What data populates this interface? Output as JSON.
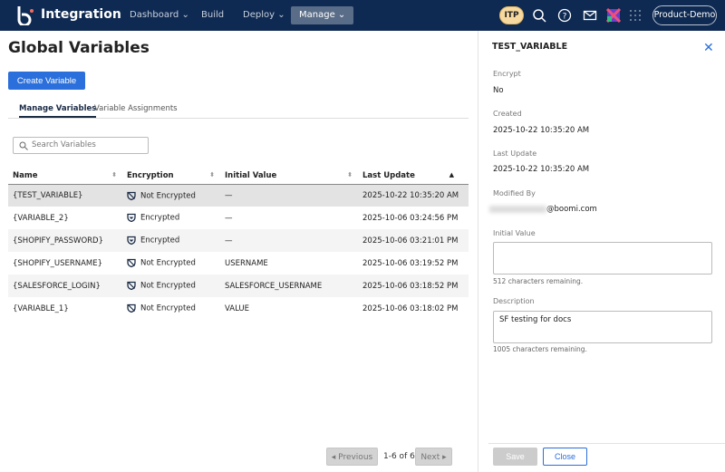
{
  "header": {
    "brand": "Integration",
    "nav": [
      {
        "label": "Dashboard"
      },
      {
        "label": "Build"
      },
      {
        "label": "Deploy"
      },
      {
        "label": "Manage"
      }
    ],
    "account_badge": "ITP",
    "profile": "Product-Demo"
  },
  "page": {
    "title": "Global Variables",
    "create_label": "Create Variable",
    "tabs": [
      {
        "label": "Manage Variables"
      },
      {
        "label": "Variable Assignments"
      }
    ],
    "search_placeholder": "Search Variables"
  },
  "table": {
    "columns": [
      "Name",
      "Encryption",
      "Initial Value",
      "Last Update"
    ],
    "sort": {
      "column": "Last Update",
      "direction": "descending"
    },
    "rows": [
      {
        "name": "{TEST_VARIABLE}",
        "encryption": "Not Encrypted",
        "initial": "—",
        "updated": "2025-10-22 10:35:20 AM"
      },
      {
        "name": "{VARIABLE_2}",
        "encryption": "Encrypted",
        "initial": "—",
        "updated": "2025-10-06 03:24:56 PM"
      },
      {
        "name": "{SHOPIFY_PASSWORD}",
        "encryption": "Encrypted",
        "initial": "—",
        "updated": "2025-10-06 03:21:01 PM"
      },
      {
        "name": "{SHOPIFY_USERNAME}",
        "encryption": "Not Encrypted",
        "initial": "USERNAME",
        "updated": "2025-10-06 03:19:52 PM"
      },
      {
        "name": "{SALESFORCE_LOGIN}",
        "encryption": "Not Encrypted",
        "initial": "SALESFORCE_USERNAME",
        "updated": "2025-10-06 03:18:52 PM"
      },
      {
        "name": "{VARIABLE_1}",
        "encryption": "Not Encrypted",
        "initial": "VALUE",
        "updated": "2025-10-06 03:18:02 PM"
      }
    ]
  },
  "pager": {
    "previous": "Previous",
    "range": "1-6 of 6",
    "next": "Next"
  },
  "panel": {
    "title": "TEST_VARIABLE",
    "encrypt_label": "Encrypt",
    "encrypt": "No",
    "created_label": "Created",
    "created": "2025-10-22 10:35:20 AM",
    "updated_label": "Last Update",
    "updated": "2025-10-22 10:35:20 AM",
    "modified_label": "Modified By",
    "modified": "@boomi.com",
    "initial_label": "Initial Value",
    "initial": "",
    "initial_hint": "512 characters remaining.",
    "desc_label": "Description",
    "desc": "SF testing for docs",
    "desc_hint": "1005 characters remaining.",
    "save": "Save",
    "close": "Close"
  },
  "colors": {
    "header": "#0f2a52",
    "accent": "#2a6fdb"
  }
}
